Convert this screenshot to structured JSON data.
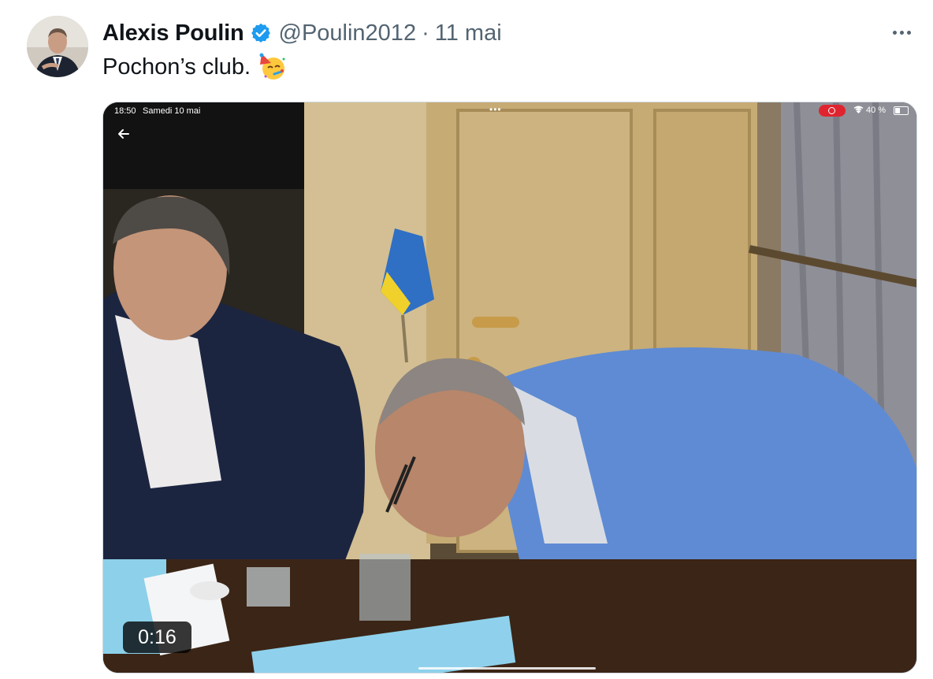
{
  "author": {
    "display_name": "Alexis Poulin",
    "handle": "@Poulin2012",
    "separator": "·",
    "timestamp": "11 mai",
    "verified": true
  },
  "tweet": {
    "text": "Pochon’s club.",
    "emoji": "party-face-emoji"
  },
  "video": {
    "duration": "0:16",
    "status_bar": {
      "time": "18:50",
      "date": "Samedi 10 mai",
      "battery": "40 %",
      "center_dots": "•••"
    }
  },
  "colors": {
    "text_primary": "#0f1419",
    "text_secondary": "#536471",
    "verified_badge": "#1d9bf0",
    "border": "#cfd9de"
  }
}
